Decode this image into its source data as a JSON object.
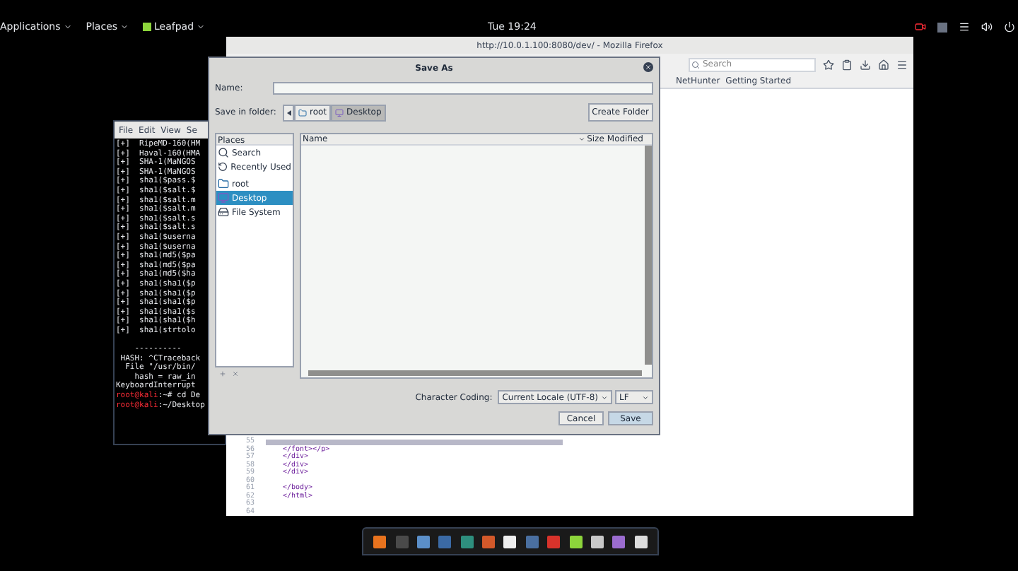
{
  "top_bar": {
    "menus": [
      {
        "label": "Applications"
      },
      {
        "label": "Places"
      },
      {
        "label": "Leafpad",
        "kind": "app"
      }
    ],
    "clock": "Tue 19:24"
  },
  "firefox": {
    "title": "http://10.0.1.100:8080/dev/ - Mozilla Firefox",
    "search": {
      "placeholder": "Search"
    },
    "bookmarks": [
      "NetHunter",
      "Getting Started"
    ],
    "code_lines": [
      {
        "number": "55",
        "highlighted": true
      },
      {
        "number": "56",
        "text": "</font></p>",
        "highlighted": false
      },
      {
        "number": "57",
        "text": "</div>",
        "highlighted": false
      },
      {
        "number": "58",
        "text": "</div>",
        "highlighted": false
      },
      {
        "number": "59",
        "text": "</div>",
        "highlighted": false
      },
      {
        "number": "60",
        "highlighted": false
      },
      {
        "number": "61",
        "text": "</body>",
        "highlighted": false
      },
      {
        "number": "62",
        "text": "</html>",
        "highlighted": false
      },
      {
        "number": "63",
        "highlighted": false
      },
      {
        "number": "64",
        "highlighted": false
      }
    ]
  },
  "terminal": {
    "menu": [
      "File",
      "Edit",
      "View",
      "Se"
    ],
    "lines": [
      {
        "kind": "output",
        "text": "[+]  RipeMD-160(HM"
      },
      {
        "kind": "output",
        "text": "[+]  Haval-160(HMA"
      },
      {
        "kind": "output",
        "text": "[+]  SHA-1(MaNGOS"
      },
      {
        "kind": "output",
        "text": "[+]  SHA-1(MaNGOS"
      },
      {
        "kind": "output",
        "text": "[+]  sha1($pass.$"
      },
      {
        "kind": "output",
        "text": "[+]  sha1($salt.$"
      },
      {
        "kind": "output",
        "text": "[+]  sha1($salt.m"
      },
      {
        "kind": "output",
        "text": "[+]  sha1($salt.m"
      },
      {
        "kind": "output",
        "text": "[+]  sha1($salt.s"
      },
      {
        "kind": "output",
        "text": "[+]  sha1($salt.s"
      },
      {
        "kind": "output",
        "text": "[+]  sha1($userna"
      },
      {
        "kind": "output",
        "text": "[+]  sha1($userna"
      },
      {
        "kind": "output",
        "text": "[+]  sha1(md5($pa"
      },
      {
        "kind": "output",
        "text": "[+]  sha1(md5($pa"
      },
      {
        "kind": "output",
        "text": "[+]  sha1(md5($ha"
      },
      {
        "kind": "output",
        "text": "[+]  sha1(sha1($p"
      },
      {
        "kind": "output",
        "text": "[+]  sha1(sha1($p"
      },
      {
        "kind": "output",
        "text": "[+]  sha1(sha1($p"
      },
      {
        "kind": "output",
        "text": "[+]  sha1(sha1($s"
      },
      {
        "kind": "output",
        "text": "[+]  sha1(sha1($h"
      },
      {
        "kind": "output",
        "text": "[+]  sha1(strtolo"
      },
      {
        "kind": "blank"
      },
      {
        "kind": "output",
        "text": "    ----------"
      },
      {
        "kind": "output",
        "text": " HASH: ^CTraceback"
      },
      {
        "kind": "output",
        "text": "  File \"/usr/bin/"
      },
      {
        "kind": "output",
        "text": "    hash = raw_in"
      },
      {
        "kind": "output",
        "text": "KeyboardInterrupt"
      },
      {
        "kind": "prompt",
        "prompt": "root@kali",
        "text": ":~# cd De"
      },
      {
        "kind": "prompt",
        "prompt": "root@kali",
        "text": ":~/Desktop"
      }
    ]
  },
  "save_dialog": {
    "title": "Save As",
    "name_label": "Name:",
    "folder_label": "Save in folder:",
    "path": [
      {
        "label": "root",
        "selected": false
      },
      {
        "label": "Desktop",
        "selected": true
      }
    ],
    "create_folder": "Create Folder",
    "places_header": "Places",
    "places": [
      {
        "label": "Search",
        "kind": "search",
        "selected": false
      },
      {
        "label": "Recently Used",
        "kind": "recent",
        "selected": false
      },
      {
        "label": "root",
        "kind": "folder",
        "selected": false
      },
      {
        "label": "Desktop",
        "kind": "desktop",
        "selected": true
      },
      {
        "label": "File System",
        "kind": "drive",
        "selected": false
      }
    ],
    "columns": [
      "Name",
      "Size",
      "Modified"
    ],
    "coding_label": "Character Coding:",
    "coding_value": "Current Locale (UTF-8)",
    "line_ending": "LF",
    "buttons": [
      {
        "label": "Cancel",
        "kind": "normal"
      },
      {
        "label": "Save",
        "kind": "default"
      }
    ]
  }
}
